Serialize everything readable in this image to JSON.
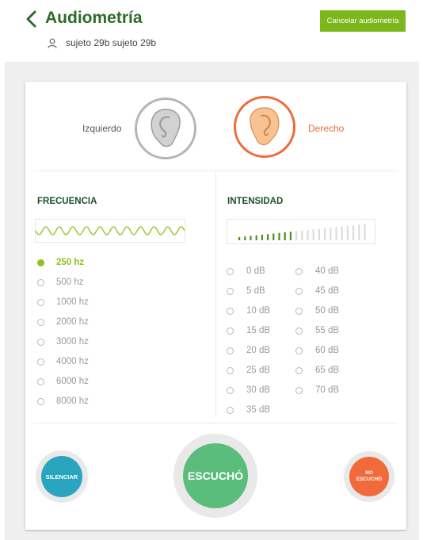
{
  "header": {
    "title": "Audiometría",
    "subject": "sujeto 29b sujeto 29b",
    "cancel_label": "Cancelar audiometría"
  },
  "ears": {
    "left_label": "Izquierdo",
    "right_label": "Derecho",
    "left_color": "#a6a6a6",
    "right_color": "#f16a3a",
    "selected": "right"
  },
  "frequency": {
    "title": "FRECUENCIA",
    "selected": "250 hz",
    "options": [
      "250 hz",
      "500 hz",
      "1000 hz",
      "2000 hz",
      "3000 hz",
      "4000 hz",
      "6000 hz",
      "8000 hz"
    ]
  },
  "intensity": {
    "title": "INTENSIDAD",
    "level_fraction": 0.43,
    "col1": [
      "0 dB",
      "5 dB",
      "10 dB",
      "15 dB",
      "20 dB",
      "25 dB",
      "30 dB",
      "35 dB"
    ],
    "col2": [
      "40 dB",
      "45 dB",
      "50 dB",
      "55 dB",
      "60 dB",
      "65 dB",
      "70 dB"
    ]
  },
  "actions": {
    "silence_label": "SILENCIAR",
    "heard_label": "ESCUCHÓ",
    "not_heard_label_1": "NO",
    "not_heard_label_2": "ESCUCHÓ",
    "silence_color": "#2aa5bf",
    "heard_color": "#5bbd7b",
    "not_heard_color": "#f16a3a"
  },
  "colors": {
    "brand_green": "#7cb81c",
    "title_green": "#2d6b2a",
    "accent_green": "#8cc21d"
  }
}
